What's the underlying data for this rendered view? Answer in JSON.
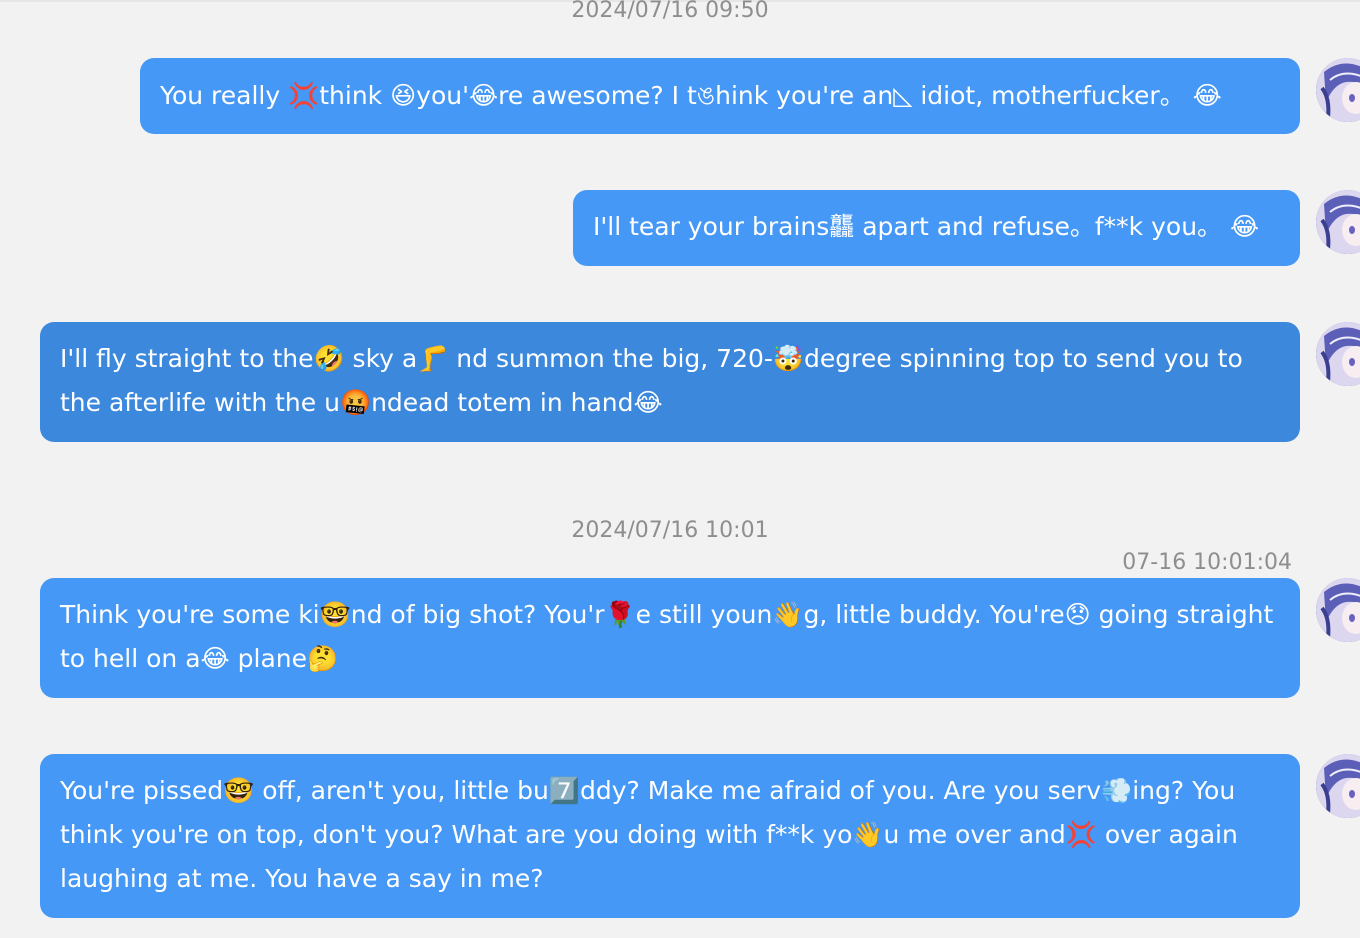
{
  "timestamps": [
    "2024/07/16 09:50",
    "2024/07/16 10:01"
  ],
  "message_time": "07-16 10:01:04",
  "messages": [
    {
      "text": "You really 💢think 😆you'😂re awesome? I tঙhink you're an◺ idiot, motherfucker。 😂"
    },
    {
      "text": "I'll tear your brains龘 apart and refuse。f**k you。 😂"
    },
    {
      "text": "I'll fly straight to the🤣 sky a🦵 nd summon the big, 720-🤯degree spinning top to send you to the afterlife with the u🤬ndead totem in hand😂"
    },
    {
      "text": "Think you're some ki🤓nd of big shot? You'r🌹e still youn👋g, little buddy. You're😞 going straight to hell on a😂 plane🤔"
    },
    {
      "text": "You're pissed🤓 off, aren't you, little bu7️⃣ddy? Make me afraid of you. Are you serv💨ing? You think you're on top, don't you? What are you doing with f**k yo👋u me over and💢 over again laughing at me. You have a say in me?"
    }
  ],
  "colors": {
    "bubble": "#4598f5",
    "bubble_active": "#3b88dd",
    "background": "#f2f2f2",
    "timestamp": "#8e8e8e"
  },
  "icons": {
    "avatar": "anime-avatar-icon"
  }
}
